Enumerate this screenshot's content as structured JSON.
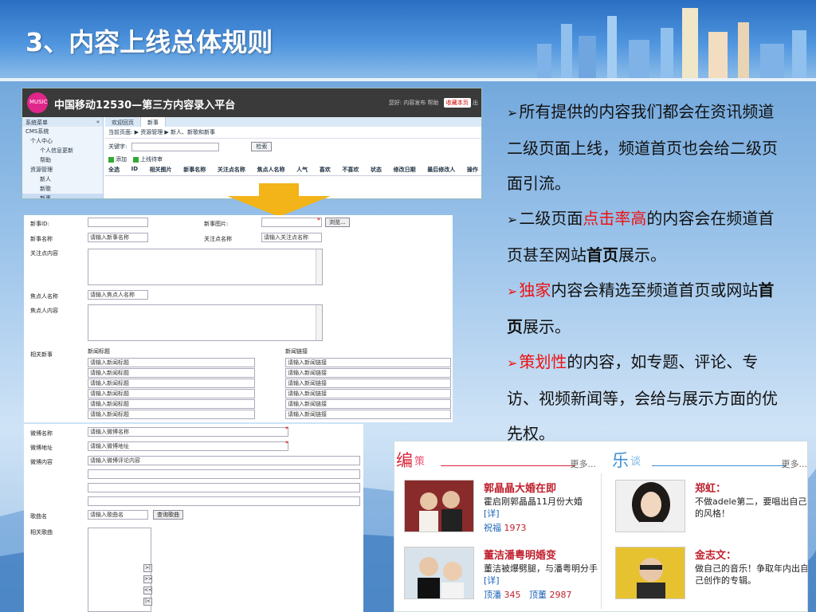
{
  "slide": {
    "title": "3、内容上线总体规则"
  },
  "cms_window": {
    "logo_text": "MUSIC",
    "title": "中国移动12530—第三方内容录入平台",
    "top_right": "您好: 内容发布  帮助",
    "fav_button": "收藏本页",
    "exit": "出",
    "sidebar_header": "系统菜单",
    "collapse": "«",
    "tree": [
      "CMS系统",
      "个人中心",
      "个人信息更新",
      "帮助",
      "资源管理",
      "新人",
      "新歌",
      "新事"
    ],
    "tabs": [
      "欢迎回页",
      "新事"
    ],
    "breadcrumb": "当前页面: ▶ 资源管理 ▶ 新人、新歌和新事",
    "keyword_label": "关键字:",
    "search_button": "检索",
    "actions": [
      "添加",
      "上线待审"
    ],
    "columns": [
      "全选",
      "ID",
      "相关图片",
      "新事名称",
      "关注点名称",
      "焦点人名称",
      "人气",
      "喜欢",
      "不喜欢",
      "状态",
      "修改日期",
      "最后修改人",
      "操作"
    ]
  },
  "form": {
    "id_label": "新事ID:",
    "image_label": "新事图片:",
    "browse_button": "浏览...",
    "name_label": "新事名称",
    "name_placeholder": "请输入新事名称",
    "focus_label": "关注点名称",
    "focus_placeholder": "请输入关注点名称",
    "focus_content_label": "关注点内容",
    "person_label": "焦点人名称",
    "person_placeholder": "请输入焦点人名称",
    "person_content_label": "焦点人内容",
    "related_label": "相关新事",
    "news_title_header": "新闻标题",
    "news_link_header": "新闻链接",
    "news_title_placeholder": "请输入新闻标题",
    "news_link_placeholder": "请输入新闻链接",
    "weibo_name_label": "微博名称",
    "weibo_name_placeholder": "请输入微博名称",
    "weibo_addr_label": "微博地址",
    "weibo_addr_placeholder": "请输入微博地址",
    "weibo_content_label": "微博内容",
    "weibo_content_placeholder": "请输入微博评论内容",
    "song_label": "歌曲名",
    "song_placeholder": "请输入歌曲名",
    "song_query_button": "查询歌曲",
    "related_song_label": "相关歌曲",
    "pager": [
      ">|",
      ">>",
      "<<",
      "|<"
    ],
    "required_mark": "*"
  },
  "bullets": [
    {
      "parts": [
        {
          "t": "所有提供的内容我们都会在资讯频道二级页面上线，频道首页也会给二级页面引流。"
        }
      ]
    },
    {
      "parts": [
        {
          "t": "二级页面"
        },
        {
          "t": "点击率高",
          "style": "red"
        },
        {
          "t": "的内容会在频道首页甚至网站"
        },
        {
          "t": "首页",
          "style": "b"
        },
        {
          "t": "展示。"
        }
      ]
    },
    {
      "parts": [
        {
          "t": "独家",
          "style": "red"
        },
        {
          "t": "内容会精选至频道首页或网站"
        },
        {
          "t": "首页",
          "style": "b"
        },
        {
          "t": "展示。"
        }
      ]
    },
    {
      "parts": [
        {
          "t": "策划性",
          "style": "red"
        },
        {
          "t": "的内容，如专题、评论、专访、视频新闻等，会给与展示方面的优先权。"
        }
      ]
    }
  ],
  "bullet_marker": "➢",
  "news_panel": {
    "left": {
      "head_big": "编",
      "head_small": "策",
      "more": "更多...",
      "items": [
        {
          "headline": "郭晶晶大婚在即",
          "desc": "霍启刚郭晶晶11月份大婚",
          "link": "[详]",
          "meta_label": "祝福",
          "meta_value": "1973"
        },
        {
          "headline": "董洁潘粤明婚变",
          "desc": "董洁被爆劈腿，与潘粤明分手",
          "link": "[详]",
          "meta_label": "顶潘",
          "meta_value": "345",
          "meta_label2": "顶董",
          "meta_value2": "2987"
        }
      ]
    },
    "right": {
      "head_big": "乐",
      "head_small": "谈",
      "more": "更多...",
      "items": [
        {
          "headline": "郑虹：",
          "desc": "不做adele第二，要唱出自己的风格！"
        },
        {
          "headline": "金志文：",
          "desc": "做自己的音乐！争取年内出自己创作的专辑。"
        }
      ]
    }
  },
  "colors": {
    "accent_red": "#e11111",
    "header_blue": "#2a6fc2",
    "link_blue": "#1b63b8"
  }
}
